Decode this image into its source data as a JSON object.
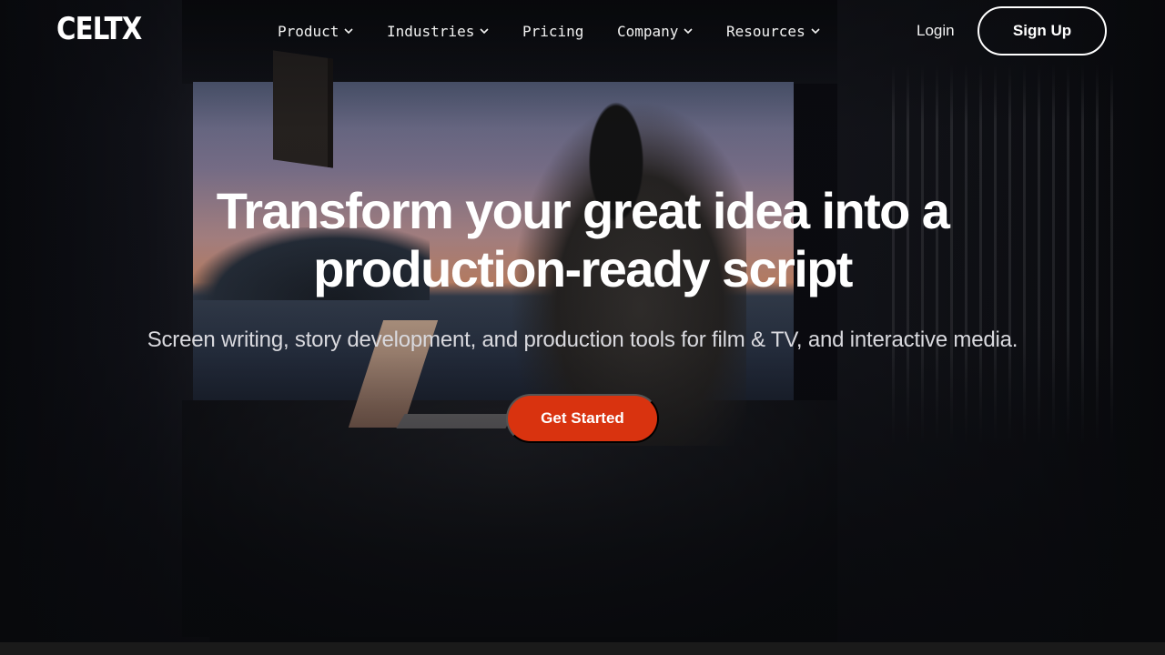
{
  "brand": {
    "logo_text": "CELTX"
  },
  "nav": {
    "items": [
      {
        "label": "Product",
        "has_dropdown": true
      },
      {
        "label": "Industries",
        "has_dropdown": true
      },
      {
        "label": "Pricing",
        "has_dropdown": false
      },
      {
        "label": "Company",
        "has_dropdown": true
      },
      {
        "label": "Resources",
        "has_dropdown": true
      }
    ],
    "login_label": "Login",
    "signup_label": "Sign Up"
  },
  "hero": {
    "headline_line1": "Transform your great idea into a",
    "headline_line2": "production-ready script",
    "subheadline": "Screen writing, story development, and production tools for film & TV, and interactive media.",
    "cta_label": "Get Started",
    "cta_color": "#d9330f"
  },
  "icons": {
    "dropdown": "chevron-down-icon"
  }
}
